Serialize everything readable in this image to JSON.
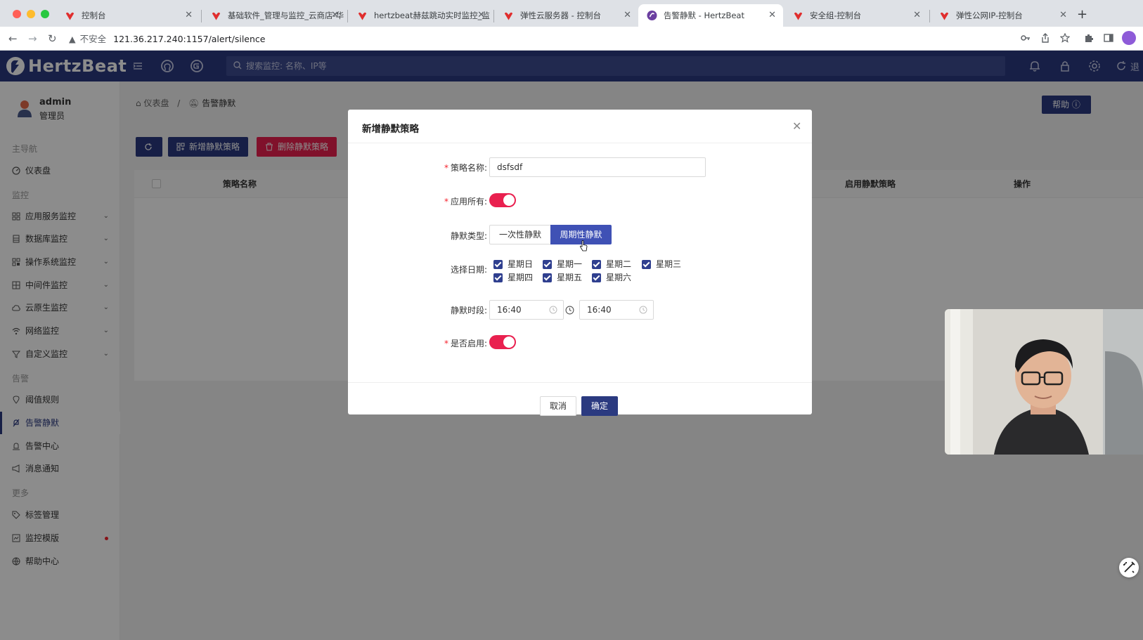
{
  "browser": {
    "tabs": [
      {
        "title": "控制台"
      },
      {
        "title": "基础软件_管理与监控_云商店-华"
      },
      {
        "title": "hertzbeat赫兹跳动实时监控_监"
      },
      {
        "title": "弹性云服务器 - 控制台"
      },
      {
        "title": "告警静默 - HertzBeat"
      },
      {
        "title": "安全组-控制台"
      },
      {
        "title": "弹性公网IP-控制台"
      }
    ],
    "url_warning": "不安全",
    "url": "121.36.217.240:1157/alert/silence"
  },
  "header": {
    "logo": "HertzBeat",
    "search_placeholder": "搜索监控: 名称、IP等",
    "more": "退"
  },
  "sidebar": {
    "user_name": "admin",
    "user_role": "管理员",
    "groups": {
      "main": "主导航",
      "monitor": "监控",
      "alert": "告警",
      "more": "更多"
    },
    "items": {
      "dashboard": "仪表盘",
      "app_monitor": "应用服务监控",
      "db_monitor": "数据库监控",
      "os_monitor": "操作系统监控",
      "middleware_monitor": "中间件监控",
      "cloud_monitor": "云原生监控",
      "network_monitor": "网络监控",
      "custom_monitor": "自定义监控",
      "threshold": "阈值规则",
      "silence": "告警静默",
      "alert_center": "告警中心",
      "notice": "消息通知",
      "tags": "标签管理",
      "templates": "监控模版",
      "help": "帮助中心"
    }
  },
  "content": {
    "breadcrumb_home": "仪表盘",
    "breadcrumb_sep": "/",
    "breadcrumb_current": "告警静默",
    "help_button": "帮助",
    "add_button": "新增静默策略",
    "delete_button": "删除静默策略",
    "columns": {
      "name": "策略名称",
      "enable": "启用静默策略",
      "action": "操作"
    }
  },
  "modal": {
    "title": "新增静默策略",
    "name_label": "策略名称",
    "name_value": "dsfsdf",
    "match_all_label": "应用所有",
    "type_label": "静默类型",
    "type_once": "一次性静默",
    "type_cyclic": "周期性静默",
    "days_label": "选择日期",
    "days": [
      "星期日",
      "星期一",
      "星期二",
      "星期三",
      "星期四",
      "星期五",
      "星期六"
    ],
    "period_label": "静默时段",
    "time_start": "16:40",
    "time_end": "16:40",
    "enable_label": "是否启用",
    "cancel": "取消",
    "ok": "确定",
    "colon": ":"
  },
  "colors": {
    "brand": "#2b3a80",
    "danger": "#e9204f",
    "selected": "#3f51b5"
  }
}
